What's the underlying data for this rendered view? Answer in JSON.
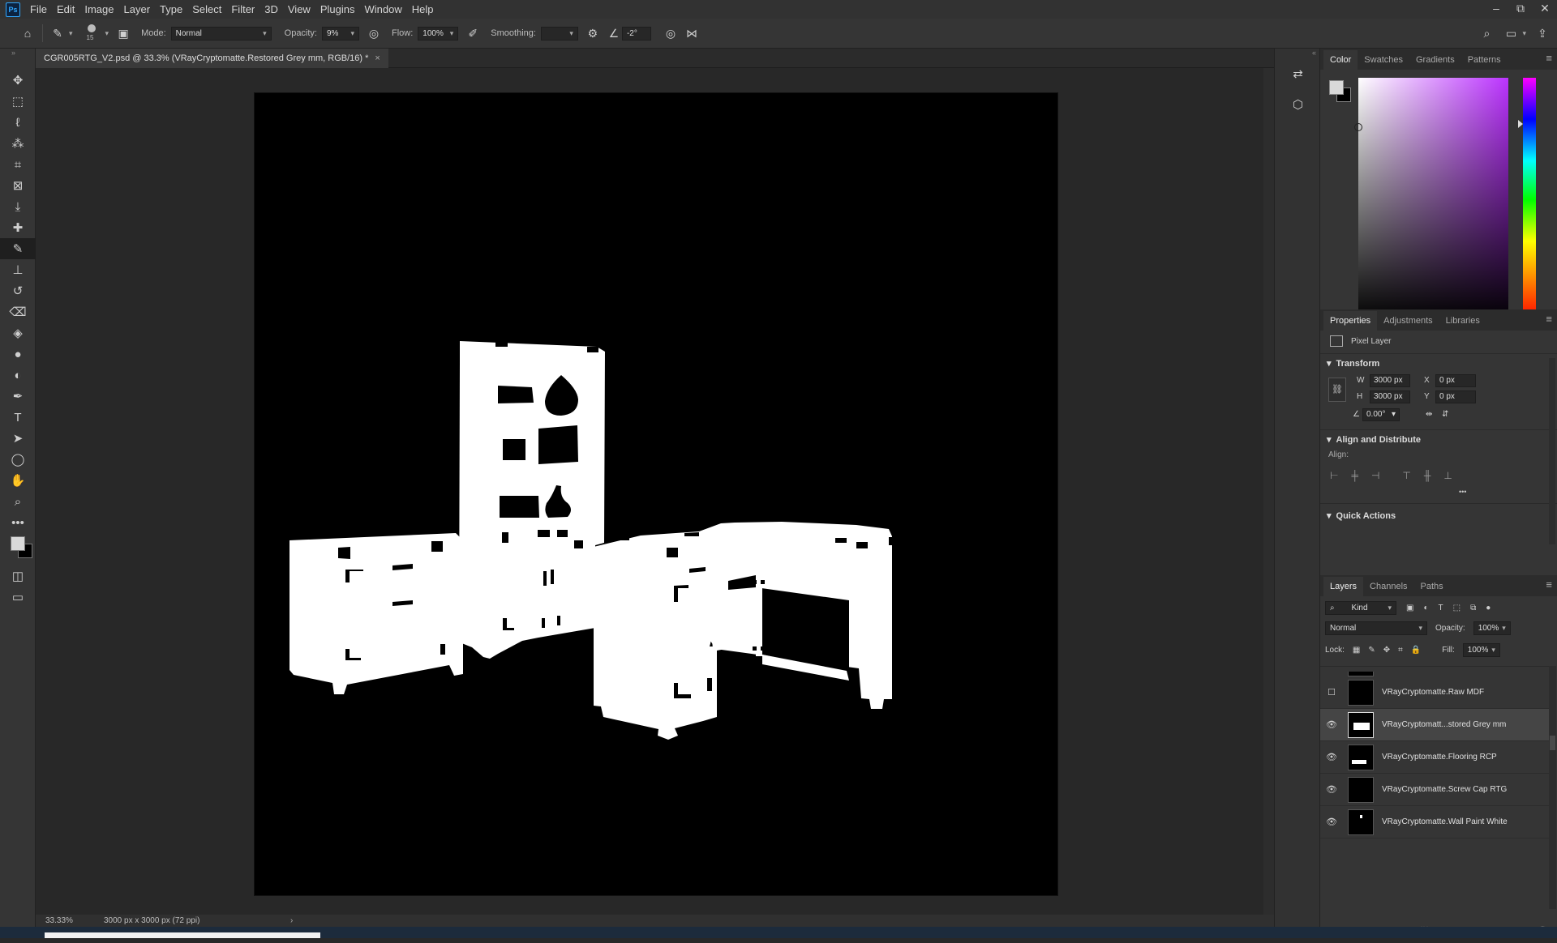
{
  "app": {
    "logo_text": "Ps",
    "accent_color": "#31a8ff"
  },
  "menu": {
    "items": [
      "File",
      "Edit",
      "Image",
      "Layer",
      "Type",
      "Select",
      "Filter",
      "3D",
      "View",
      "Plugins",
      "Window",
      "Help"
    ]
  },
  "window_controls": {
    "minimize": "–",
    "restore": "⧉",
    "close": "✕"
  },
  "options_bar": {
    "brush_size": "15",
    "mode_label": "Mode:",
    "mode_value": "Normal",
    "opacity_label": "Opacity:",
    "opacity_value": "9%",
    "flow_label": "Flow:",
    "flow_value": "100%",
    "smoothing_label": "Smoothing:",
    "smoothing_value": "",
    "angle_value": "-2°"
  },
  "document": {
    "tab_title": "CGR005RTG_V2.psd @ 33.3% (VRayCryptomatte.Restored Grey mm, RGB/16) *",
    "tab_close": "×",
    "zoom": "33.33%",
    "dimensions": "3000 px x 3000 px (72 ppi)",
    "status_arrow": "›"
  },
  "color_panel": {
    "tabs": [
      "Color",
      "Swatches",
      "Gradients",
      "Patterns"
    ],
    "foreground": "#d9d9d9",
    "background": "#000000",
    "hue_color": "#bb33ff"
  },
  "properties_panel": {
    "tabs": [
      "Properties",
      "Adjustments",
      "Libraries"
    ],
    "layer_type": "Pixel Layer",
    "transform_title": "Transform",
    "w_label": "W",
    "w_value": "3000 px",
    "h_label": "H",
    "h_value": "3000 px",
    "x_label": "X",
    "x_value": "0 px",
    "y_label": "Y",
    "y_value": "0 px",
    "angle_value": "0.00°",
    "align_title": "Align and Distribute",
    "align_label": "Align:",
    "more": "•••",
    "quick_actions_title": "Quick Actions"
  },
  "layers_panel": {
    "tabs": [
      "Layers",
      "Channels",
      "Paths"
    ],
    "filter_value": "Kind",
    "blend_mode": "Normal",
    "opacity_label": "Opacity:",
    "opacity_value": "100%",
    "lock_label": "Lock:",
    "fill_label": "Fill:",
    "fill_value": "100%",
    "layers": [
      {
        "name": "VRayCryptomatte.Raw MDF",
        "visible": false
      },
      {
        "name": "VRayCryptomatt...stored Grey mm",
        "visible": true,
        "selected": true
      },
      {
        "name": "VRayCryptomatte.Flooring RCP",
        "visible": true
      },
      {
        "name": "VRayCryptomatte.Screw Cap RTG",
        "visible": true
      },
      {
        "name": "VRayCryptomatte.Wall Paint White",
        "visible": true
      }
    ]
  }
}
